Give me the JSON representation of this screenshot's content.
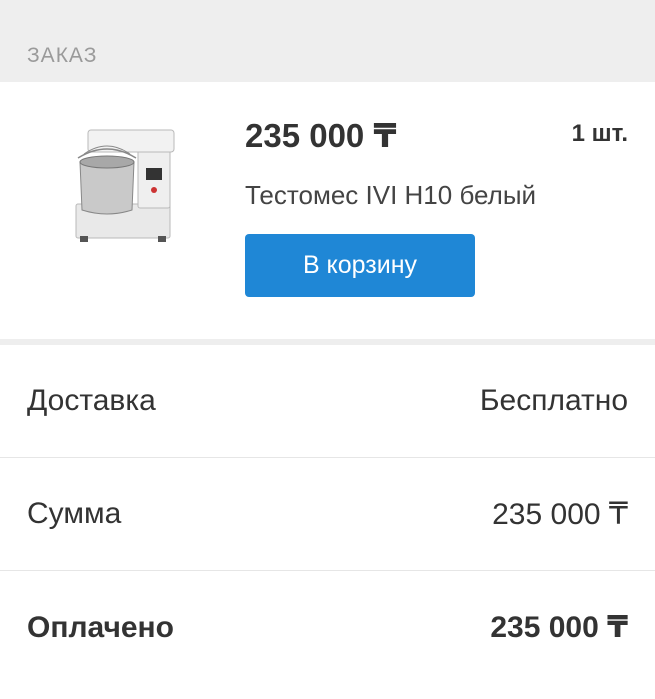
{
  "section": {
    "title": "ЗАКАЗ"
  },
  "product": {
    "price": "235 000 ₸",
    "quantity": "1 шт.",
    "name": "Тестомес IVI H10 белый",
    "cart_button_label": "В корзину",
    "image_icon": "dough-mixer-image"
  },
  "summary": {
    "delivery": {
      "label": "Доставка",
      "value": "Бесплатно"
    },
    "total": {
      "label": "Сумма",
      "value": "235 000 ₸"
    },
    "paid": {
      "label": "Оплачено",
      "value": "235 000 ₸"
    }
  },
  "colors": {
    "accent": "#1f87d6",
    "header_bg": "#eeeeee"
  }
}
